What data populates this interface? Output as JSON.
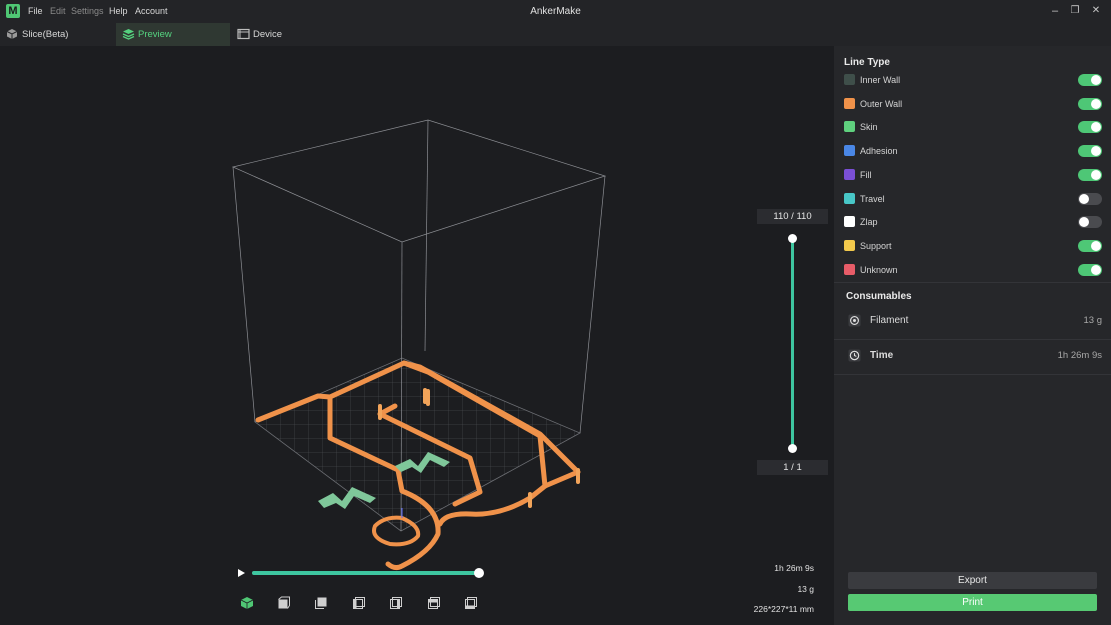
{
  "app": {
    "title": "AnkerMake",
    "logo_letter": "M"
  },
  "menu": [
    "File",
    "Edit",
    "Settings",
    "Help",
    "Account"
  ],
  "window_controls": {
    "minimize": "–",
    "restore": "❐",
    "close": "✕"
  },
  "tabs": [
    {
      "label": "Slice(Beta)",
      "icon": "cube-icon"
    },
    {
      "label": "Preview",
      "icon": "layers-icon"
    },
    {
      "label": "Device",
      "icon": "device-icon"
    }
  ],
  "line_type": {
    "title": "Line Type",
    "items": [
      {
        "label": "Inner Wall",
        "color": "#3f4f4a",
        "enabled": true
      },
      {
        "label": "Outer Wall",
        "color": "#f0924a",
        "enabled": true
      },
      {
        "label": "Skin",
        "color": "#5fd07e",
        "enabled": true
      },
      {
        "label": "Adhesion",
        "color": "#4a87e6",
        "enabled": true
      },
      {
        "label": "Fill",
        "color": "#7a4fd6",
        "enabled": true
      },
      {
        "label": "Travel",
        "color": "#48c7c7",
        "enabled": false
      },
      {
        "label": "Zlap",
        "color": "#ffffff",
        "enabled": false
      },
      {
        "label": "Support",
        "color": "#f2c94c",
        "enabled": true
      },
      {
        "label": "Unknown",
        "color": "#e85c68",
        "enabled": true
      }
    ]
  },
  "consumables": {
    "title": "Consumables",
    "filament_label": "Filament",
    "filament_value": "13 g",
    "time_label": "Time",
    "time_value": "1h 26m 9s"
  },
  "buttons": {
    "export": "Export",
    "print": "Print"
  },
  "layer_slider": {
    "top_label": "110  /  110",
    "bottom_label": "1  /  1"
  },
  "progress": {
    "fraction": 1.0
  },
  "stats": {
    "time": "1h 26m 9s",
    "weight": "13 g",
    "dimensions": "226*227*11 mm"
  },
  "view_buttons": [
    "iso-view-icon",
    "front-view-icon",
    "back-view-icon",
    "left-view-icon",
    "right-view-icon",
    "top-view-icon",
    "bottom-view-icon"
  ]
}
